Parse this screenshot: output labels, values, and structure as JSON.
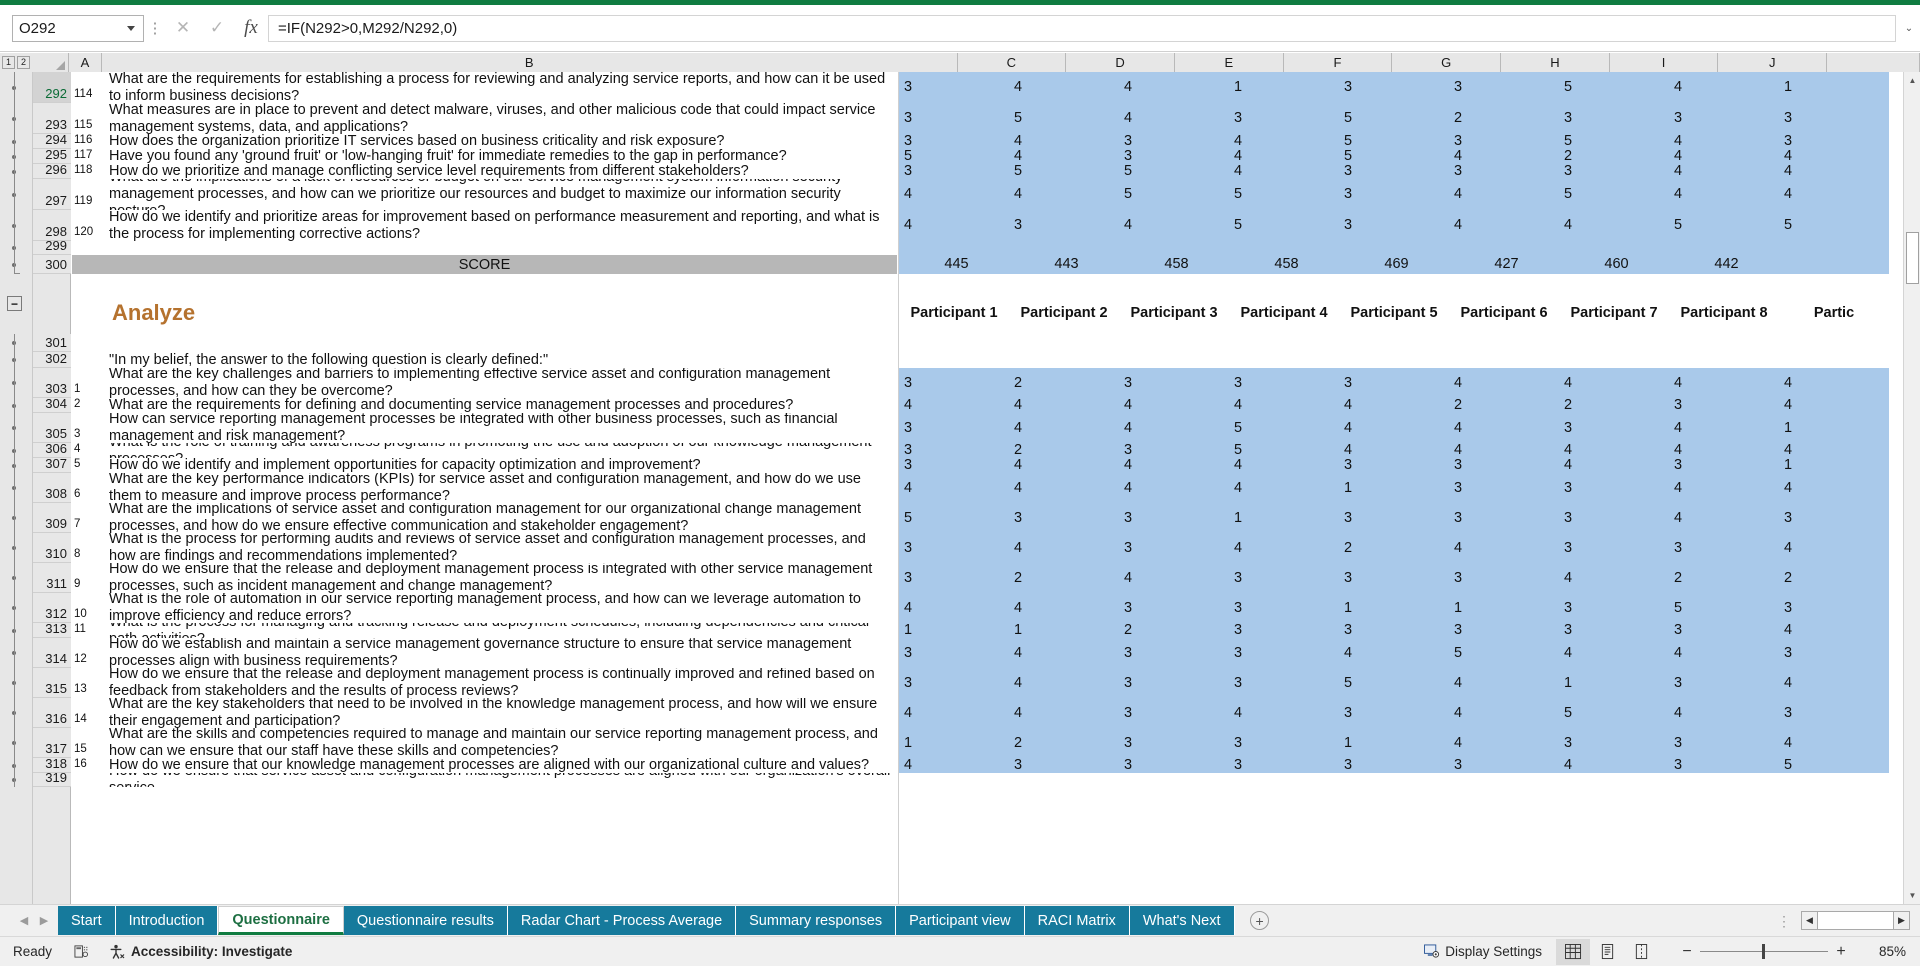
{
  "formula_bar": {
    "name_box": "O292",
    "formula": "=IF(N292>0,M292/N292,0)",
    "cancel_icon": "✕",
    "confirm_icon": "✓",
    "fx_label": "fx"
  },
  "grid": {
    "column_headers": [
      "A",
      "B",
      "C",
      "D",
      "E",
      "F",
      "G",
      "H",
      "I",
      "J"
    ],
    "outline_levels": [
      "1",
      "2"
    ],
    "row_numbers": [
      "292",
      "293",
      "294",
      "295",
      "296",
      "297",
      "298",
      "299",
      "300",
      "301",
      "302",
      "303",
      "304",
      "305",
      "306",
      "307",
      "308",
      "309",
      "310",
      "311",
      "312",
      "313",
      "314",
      "315",
      "316",
      "317",
      "318",
      "319"
    ],
    "active_row": "292",
    "top_section": {
      "rows": [
        {
          "row": "292",
          "a": "114",
          "b": "What are the requirements for establishing a process for reviewing and analyzing service reports, and how can it be used to inform business decisions?",
          "values": [
            "3",
            "4",
            "4",
            "1",
            "3",
            "3",
            "5",
            "4",
            "1"
          ]
        },
        {
          "row": "293",
          "a": "115",
          "b": "What measures are in place to prevent and detect malware, viruses, and other malicious code that could impact service management systems, data, and applications?",
          "values": [
            "3",
            "5",
            "4",
            "3",
            "5",
            "2",
            "3",
            "3",
            "3"
          ]
        },
        {
          "row": "294",
          "a": "116",
          "b": "How does the organization prioritize IT services based on business criticality and risk exposure?",
          "values": [
            "3",
            "4",
            "3",
            "4",
            "5",
            "3",
            "5",
            "4",
            "3"
          ]
        },
        {
          "row": "295",
          "a": "117",
          "b": "Have you found any 'ground fruit' or 'low-hanging fruit' for immediate remedies to the gap in performance?",
          "values": [
            "5",
            "4",
            "3",
            "4",
            "5",
            "4",
            "2",
            "4",
            "4"
          ]
        },
        {
          "row": "296",
          "a": "118",
          "b": "How do we prioritize and manage conflicting service level requirements from different stakeholders?",
          "values": [
            "3",
            "5",
            "5",
            "4",
            "3",
            "3",
            "3",
            "4",
            "4"
          ]
        },
        {
          "row": "297",
          "a": "119",
          "b": "What are the implications of a lack of resources or budget on our service management system information security management processes, and how can we prioritize our resources and budget to maximize our information security posture?",
          "values": [
            "4",
            "4",
            "5",
            "5",
            "3",
            "4",
            "5",
            "4",
            "4"
          ]
        },
        {
          "row": "298",
          "a": "120",
          "b": "How do we identify and prioritize areas for improvement based on performance measurement and reporting, and what is the process for implementing corrective actions?",
          "values": [
            "4",
            "3",
            "4",
            "5",
            "3",
            "4",
            "4",
            "5",
            "5"
          ]
        },
        {
          "row": "299",
          "a": "",
          "b": "",
          "values": [
            "",
            "",
            "",
            "",
            "",
            "",
            "",
            "",
            ""
          ]
        }
      ],
      "score_row": {
        "row": "300",
        "label": "SCORE",
        "values": [
          "445",
          "443",
          "458",
          "458",
          "469",
          "427",
          "460",
          "442",
          ""
        ]
      }
    },
    "analyze_section": {
      "title": "Analyze",
      "title_row": "301",
      "participant_headers": [
        "Participant 1",
        "Participant 2",
        "Participant 3",
        "Participant 4",
        "Participant 5",
        "Participant 6",
        "Participant 7",
        "Participant 8",
        "Partic"
      ],
      "prompt_row": {
        "row": "302",
        "a": "",
        "b": "\"In my belief, the answer to the following question is clearly defined:\"",
        "values": [
          "",
          "",
          "",
          "",
          "",
          "",
          "",
          "",
          ""
        ]
      },
      "rows": [
        {
          "row": "303",
          "a": "1",
          "b": "What are the key challenges and barriers to implementing effective service asset and configuration management processes, and how can they be overcome?",
          "values": [
            "3",
            "2",
            "3",
            "3",
            "3",
            "4",
            "4",
            "4",
            "4"
          ]
        },
        {
          "row": "304",
          "a": "2",
          "b": "What are the requirements for defining and documenting service management processes and procedures?",
          "values": [
            "4",
            "4",
            "4",
            "4",
            "4",
            "2",
            "2",
            "3",
            "4"
          ]
        },
        {
          "row": "305",
          "a": "3",
          "b": "How can service reporting management processes be integrated with other business processes, such as financial management and risk management?",
          "values": [
            "3",
            "4",
            "4",
            "5",
            "4",
            "4",
            "3",
            "4",
            "1"
          ]
        },
        {
          "row": "306",
          "a": "4",
          "b": "What is the role of training and awareness programs in promoting the use and adoption of our knowledge management processes?",
          "values": [
            "3",
            "2",
            "3",
            "5",
            "4",
            "4",
            "4",
            "4",
            "4"
          ]
        },
        {
          "row": "307",
          "a": "5",
          "b": "How do we identify and implement opportunities for capacity optimization and improvement?",
          "values": [
            "3",
            "4",
            "4",
            "4",
            "3",
            "3",
            "4",
            "3",
            "1"
          ]
        },
        {
          "row": "308",
          "a": "6",
          "b": "What are the key performance indicators (KPIs) for service asset and configuration management, and how do we use them to measure and improve process performance?",
          "values": [
            "4",
            "4",
            "4",
            "4",
            "1",
            "3",
            "3",
            "4",
            "4"
          ]
        },
        {
          "row": "309",
          "a": "7",
          "b": "What are the implications of service asset and configuration management for our organizational change management processes, and how do we ensure effective communication and stakeholder engagement?",
          "values": [
            "5",
            "3",
            "3",
            "1",
            "3",
            "3",
            "3",
            "4",
            "3"
          ]
        },
        {
          "row": "310",
          "a": "8",
          "b": "What is the process for performing audits and reviews of service asset and configuration management processes, and how are findings and recommendations implemented?",
          "values": [
            "3",
            "4",
            "3",
            "4",
            "2",
            "4",
            "3",
            "3",
            "4"
          ]
        },
        {
          "row": "311",
          "a": "9",
          "b": "How do we ensure that the release and deployment management process is integrated with other service management processes, such as incident management and change management?",
          "values": [
            "3",
            "2",
            "4",
            "3",
            "3",
            "3",
            "4",
            "2",
            "2"
          ]
        },
        {
          "row": "312",
          "a": "10",
          "b": "What is the role of automation in our service reporting management process, and how can we leverage automation to improve efficiency and reduce errors?",
          "values": [
            "4",
            "4",
            "3",
            "3",
            "1",
            "1",
            "3",
            "5",
            "3"
          ]
        },
        {
          "row": "313",
          "a": "11",
          "b": "What is the process for managing and tracking release and deployment schedules, including dependencies and critical path activities?",
          "values": [
            "1",
            "1",
            "2",
            "3",
            "3",
            "3",
            "3",
            "3",
            "4"
          ]
        },
        {
          "row": "314",
          "a": "12",
          "b": "How do we establish and maintain a service management governance structure to ensure that service management processes align with business requirements?",
          "values": [
            "3",
            "4",
            "3",
            "3",
            "4",
            "5",
            "4",
            "4",
            "3"
          ]
        },
        {
          "row": "315",
          "a": "13",
          "b": "How do we ensure that the release and deployment management process is continually improved and refined based on feedback from stakeholders and the results of process reviews?",
          "values": [
            "3",
            "4",
            "3",
            "3",
            "5",
            "4",
            "1",
            "3",
            "4"
          ]
        },
        {
          "row": "316",
          "a": "14",
          "b": "What are the key stakeholders that need to be involved in the knowledge management process, and how will we ensure their engagement and participation?",
          "values": [
            "4",
            "4",
            "3",
            "4",
            "3",
            "4",
            "5",
            "4",
            "3"
          ]
        },
        {
          "row": "317",
          "a": "15",
          "b": "What are the skills and competencies required to manage and maintain our service reporting management process, and how can we ensure that our staff have these skills and competencies?",
          "values": [
            "1",
            "2",
            "3",
            "3",
            "1",
            "4",
            "3",
            "3",
            "4"
          ]
        },
        {
          "row": "318",
          "a": "16",
          "b": "How do we ensure that our knowledge management processes are aligned with our organizational culture and values?",
          "values": [
            "4",
            "3",
            "3",
            "3",
            "3",
            "3",
            "4",
            "3",
            "5"
          ]
        },
        {
          "row": "319",
          "a": "",
          "b": "How do we ensure that service asset and configuration management processes are aligned with our organization's overall service",
          "values": [
            "",
            "",
            "",
            "",
            "",
            "",
            "",
            "",
            ""
          ]
        }
      ]
    }
  },
  "sheet_tabs": {
    "items": [
      {
        "label": "Start",
        "active": false
      },
      {
        "label": "Introduction",
        "active": false
      },
      {
        "label": "Questionnaire",
        "active": true
      },
      {
        "label": "Questionnaire results",
        "active": false
      },
      {
        "label": "Radar Chart - Process Average",
        "active": false
      },
      {
        "label": "Summary responses",
        "active": false
      },
      {
        "label": "Participant view",
        "active": false
      },
      {
        "label": "RACI Matrix",
        "active": false
      },
      {
        "label": "What's Next",
        "active": false
      }
    ],
    "add_sheet_icon": "+",
    "nav_prev_icon": "◀",
    "nav_next_icon": "▶"
  },
  "status_bar": {
    "ready": "Ready",
    "accessibility": "Accessibility: Investigate",
    "display_settings": "Display Settings",
    "zoom": "85%",
    "zoom_out_icon": "−",
    "zoom_in_icon": "+",
    "view_normal_icon": "normal-view-icon",
    "view_pagelayout_icon": "page-layout-icon",
    "view_pagebreak_icon": "page-break-icon"
  },
  "colors": {
    "accent_green": "#107c41",
    "tab_teal": "#167a9c",
    "data_blue": "#a9c9ea",
    "score_gray": "#b7b7b7",
    "section_title": "#b5722e"
  }
}
